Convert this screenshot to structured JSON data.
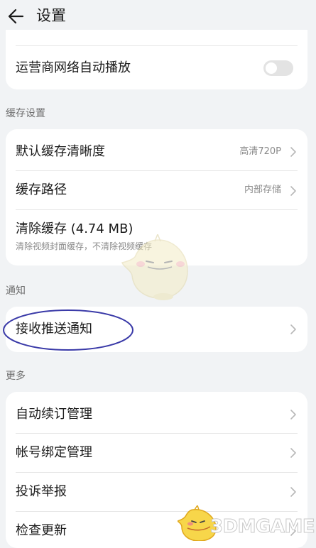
{
  "header": {
    "title": "设置",
    "back_icon": "arrow-left-icon"
  },
  "top_card": {
    "autoplay_label": "运营商网络自动播放",
    "autoplay_enabled": false
  },
  "cache_section": {
    "title": "缓存设置",
    "items": [
      {
        "label": "默认缓存清晰度",
        "value": "高清720P"
      },
      {
        "label": "缓存路径",
        "value": "内部存储"
      }
    ],
    "clear": {
      "label": "清除缓存 (4.74 MB)",
      "sub": "清除视频封面缓存，不清除视频缓存"
    }
  },
  "notify_section": {
    "title": "通知",
    "push_label": "接收推送通知"
  },
  "more_section": {
    "title": "更多",
    "items": [
      {
        "label": "自动续订管理"
      },
      {
        "label": "帐号绑定管理"
      },
      {
        "label": "投诉举报"
      },
      {
        "label": "检查更新"
      }
    ]
  },
  "annotation": {
    "ellipse_color": "#3a3aa8"
  },
  "watermark": {
    "brand": "3DMGAME"
  },
  "colors": {
    "background": "#f1f3f5",
    "card": "#ffffff",
    "secondary_text": "#8a8a8a",
    "toggle_off": "#e3e3e3"
  }
}
